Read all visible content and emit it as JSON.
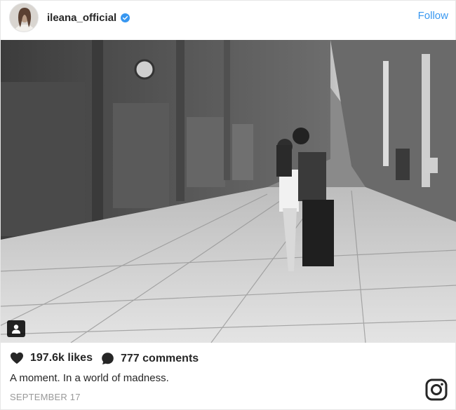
{
  "header": {
    "username": "ileana_official",
    "verified_icon": "verified-badge-icon",
    "follow_label": "Follow"
  },
  "photo": {
    "tag_icon": "user-tag-icon"
  },
  "stats": {
    "likes_label": "197.6k likes",
    "comments_label": "777 comments"
  },
  "caption": "A moment. In a world of madness.",
  "date": "SEPTEMBER 17",
  "colors": {
    "accent": "#3897f0",
    "text": "#262626",
    "muted": "#999999"
  }
}
